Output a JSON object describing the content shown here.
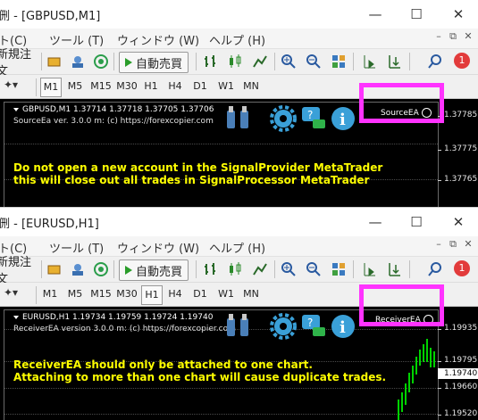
{
  "windows": [
    {
      "title": "侀 - [GBPUSD,M1]",
      "menu": [
        "ト(C)",
        "ツール (T)",
        "ウィンドウ (W)",
        "ヘルプ (H)"
      ],
      "toolbar": {
        "new_order": "新規注文",
        "auto_trade": "自動売買",
        "notification_count": "1"
      },
      "timeframes": [
        "M1",
        "M5",
        "M15",
        "M30",
        "H1",
        "H4",
        "D1",
        "W1",
        "MN"
      ],
      "active_timeframe": "M1",
      "chart": {
        "symbol_line": "GBPUSD,M1  1.37714 1.37718 1.37705 1.37706",
        "ea_info": "SourceEa  ver. 3.0.0 m: (c) https://forexcopier.com",
        "ea_label": "SourceEA",
        "warning_lines": [
          "Do not open a new account in the SignalProvider MetaTrader",
          "this will close out all trades in SignalProcessor MetaTrader"
        ],
        "prices": [
          "1.37785",
          "1.37775",
          "1.37765"
        ]
      }
    },
    {
      "title": "侀 - [EURUSD,H1]",
      "menu": [
        "ト(C)",
        "ツール (T)",
        "ウィンドウ (W)",
        "ヘルプ (H)"
      ],
      "toolbar": {
        "new_order": "新規注文",
        "auto_trade": "自動売買",
        "notification_count": "1"
      },
      "timeframes": [
        "M1",
        "M5",
        "M15",
        "M30",
        "H1",
        "H4",
        "D1",
        "W1",
        "MN"
      ],
      "active_timeframe": "H1",
      "chart": {
        "symbol_line": "EURUSD,H1  1.19734 1.19759 1.19724 1.19740",
        "ea_info": "ReceiverEA  version 3.0.0 m: (c) https://forexcopier.com",
        "ea_label": "ReceiverEA",
        "warning_lines": [
          "ReceiverEA should only be attached to one chart.",
          "Attaching to more than one chart will cause duplicate trades."
        ],
        "prices": [
          "1.19935",
          "1.19795",
          "1.19740",
          "1.19660",
          "1.19520"
        ]
      }
    }
  ],
  "colors": {
    "highlight": "#ff33ff",
    "warning_text": "#ffff00",
    "chart_bg": "#000000",
    "candle": "#00d200"
  }
}
